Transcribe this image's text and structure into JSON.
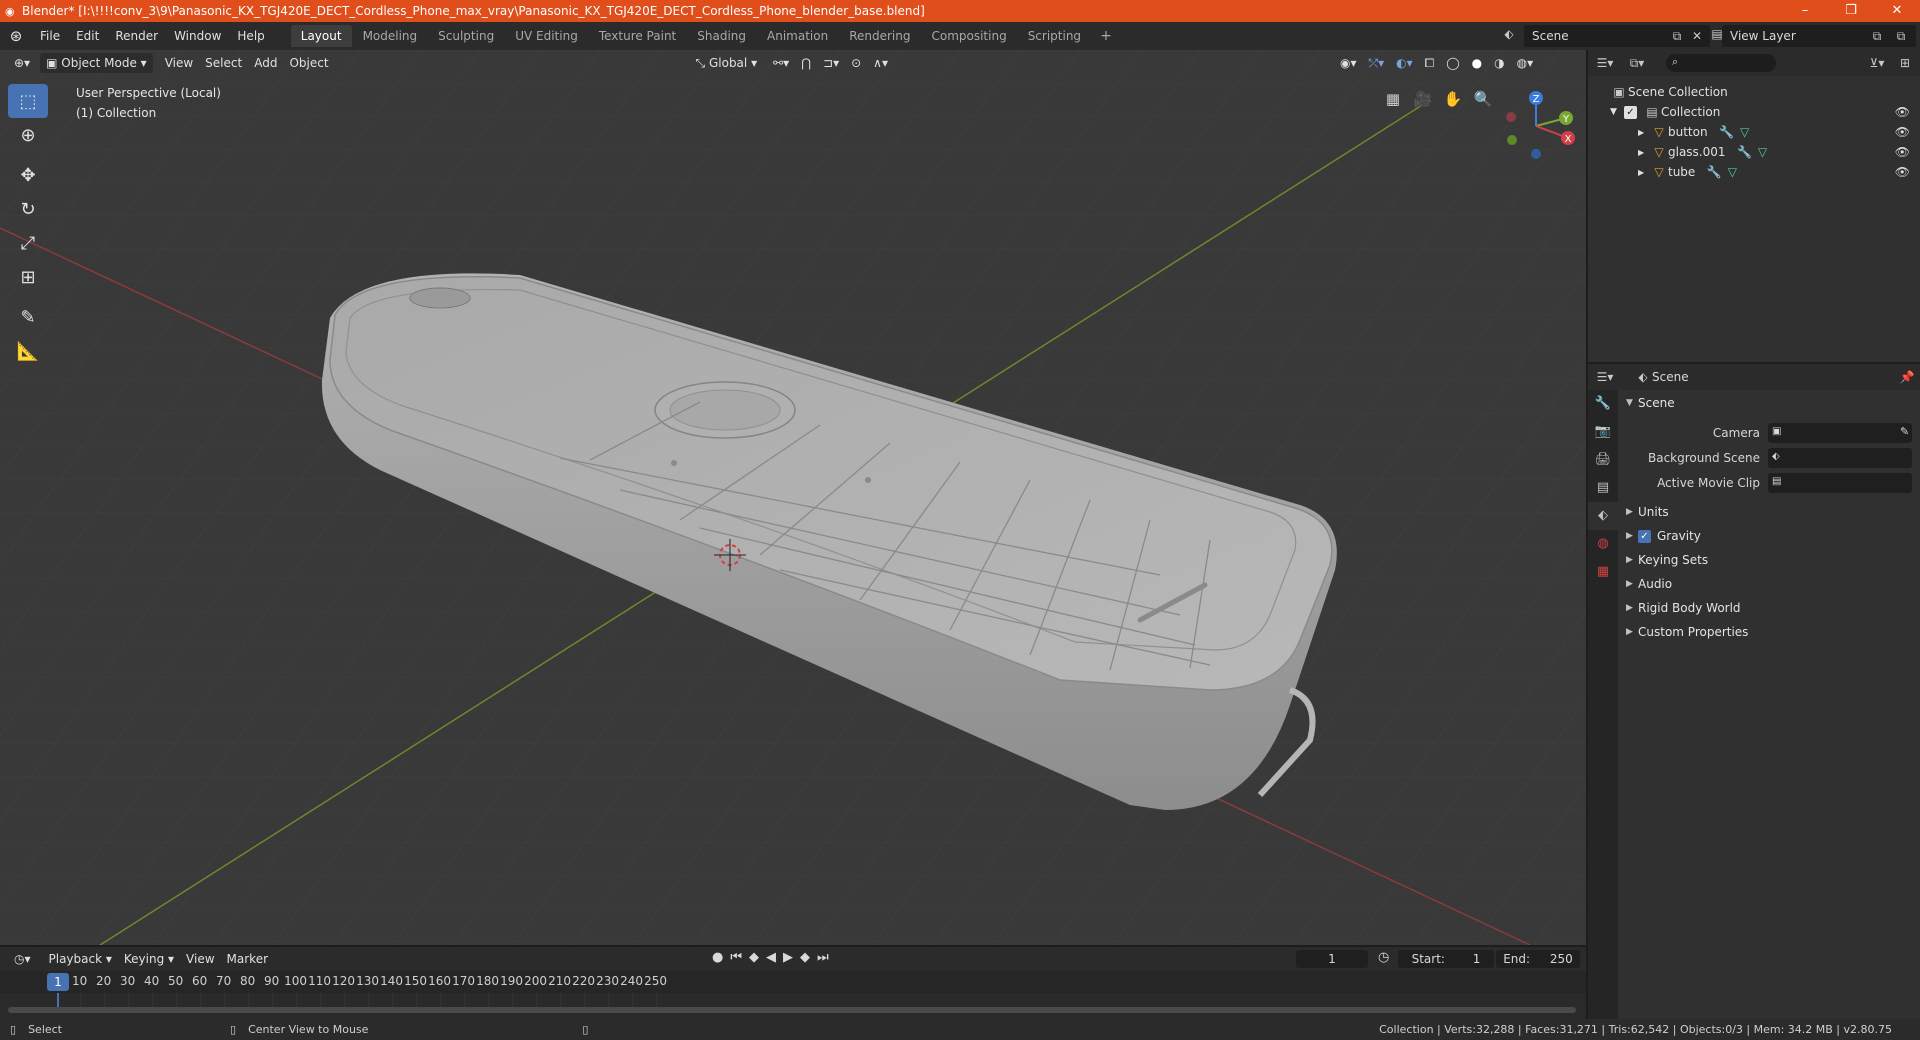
{
  "window": {
    "title": "Blender* [I:\\!!!!conv_3\\9\\Panasonic_KX_TGJ420E_DECT_Cordless_Phone_max_vray\\Panasonic_KX_TGJ420E_DECT_Cordless_Phone_blender_base.blend]",
    "minimize": "–",
    "restore": "❐",
    "close": "✕"
  },
  "menu": {
    "items": [
      "File",
      "Edit",
      "Render",
      "Window",
      "Help"
    ],
    "workspaces": [
      "Layout",
      "Modeling",
      "Sculpting",
      "UV Editing",
      "Texture Paint",
      "Shading",
      "Animation",
      "Rendering",
      "Compositing",
      "Scripting"
    ],
    "active_workspace": "Layout",
    "add_workspace": "+",
    "scene_name": "Scene",
    "view_layer": "View Layer"
  },
  "viewport": {
    "mode": "Object Mode",
    "menus": [
      "View",
      "Select",
      "Add",
      "Object"
    ],
    "orientation": "Global",
    "perspective_label": "User Perspective (Local)",
    "collection_label": "(1) Collection",
    "gizmo": {
      "x": "X",
      "y": "Y",
      "z": "Z"
    }
  },
  "outliner": {
    "root": "Scene Collection",
    "collection": "Collection",
    "objects": [
      "button",
      "glass.001",
      "tube"
    ]
  },
  "properties": {
    "context": "Scene",
    "panel": "Scene",
    "fields": [
      {
        "label": "Camera",
        "value": ""
      },
      {
        "label": "Background Scene",
        "value": ""
      },
      {
        "label": "Active Movie Clip",
        "value": ""
      }
    ],
    "subpanels": [
      "Units",
      "Gravity",
      "Keying Sets",
      "Audio",
      "Rigid Body World",
      "Custom Properties"
    ],
    "gravity_checked": true
  },
  "timeline": {
    "menus": [
      "Playback",
      "Keying",
      "View",
      "Marker"
    ],
    "current_frame": "1",
    "start_label": "Start:",
    "start": "1",
    "end_label": "End:",
    "end": "250",
    "ticks": [
      "1",
      "10",
      "20",
      "30",
      "40",
      "50",
      "60",
      "70",
      "80",
      "90",
      "100",
      "110",
      "120",
      "130",
      "140",
      "150",
      "160",
      "170",
      "180",
      "190",
      "200",
      "210",
      "220",
      "230",
      "240",
      "250"
    ]
  },
  "statusbar": {
    "left_action": "Select",
    "middle_action": "Center View to Mouse",
    "stats": "Collection | Verts:32,288 | Faces:31,271 | Tris:62,542 | Objects:0/3 | Mem: 34.2 MB | v2.80.75"
  }
}
